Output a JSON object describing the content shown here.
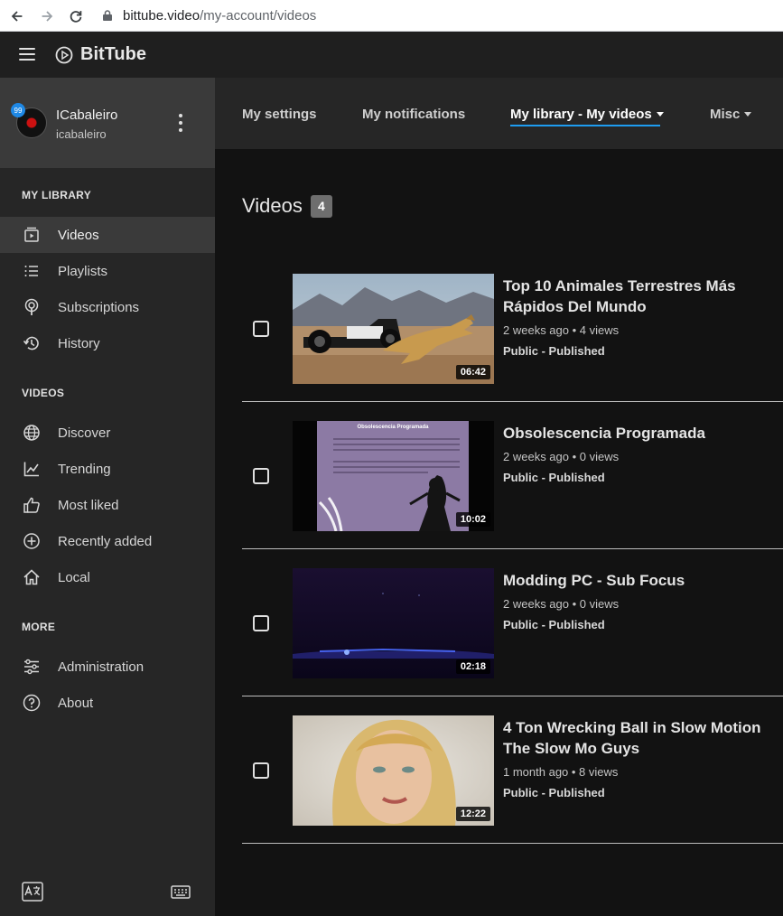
{
  "browser": {
    "url_host": "bittube.video",
    "url_path": "/my-account/videos"
  },
  "brand": {
    "name": "BitTube"
  },
  "account": {
    "name": "ICabaleiro",
    "handle": "icabaleiro",
    "badge": "99"
  },
  "sidebar": {
    "sections": [
      {
        "title": "MY LIBRARY"
      },
      {
        "title": "VIDEOS"
      },
      {
        "title": "MORE"
      }
    ],
    "items": [
      {
        "label": "Videos",
        "icon": "video-file-icon",
        "active": true
      },
      {
        "label": "Playlists",
        "icon": "playlist-icon"
      },
      {
        "label": "Subscriptions",
        "icon": "subscriptions-icon"
      },
      {
        "label": "History",
        "icon": "history-icon"
      },
      {
        "label": "Discover",
        "icon": "globe-icon"
      },
      {
        "label": "Trending",
        "icon": "trending-icon"
      },
      {
        "label": "Most liked",
        "icon": "thumbs-up-icon"
      },
      {
        "label": "Recently added",
        "icon": "plus-circle-icon"
      },
      {
        "label": "Local",
        "icon": "home-icon"
      },
      {
        "label": "Administration",
        "icon": "sliders-icon"
      },
      {
        "label": "About",
        "icon": "help-icon"
      }
    ]
  },
  "tabs": [
    {
      "label": "My settings"
    },
    {
      "label": "My notifications"
    },
    {
      "label": "My library - My videos",
      "active": true
    },
    {
      "label": "Misc"
    }
  ],
  "main": {
    "title": "Videos",
    "count": "4"
  },
  "videos": [
    {
      "title": "Top 10 Animales Terrestres Más Rápidos Del Mundo",
      "meta": "2 weeks ago • 4 views",
      "status": "Public - Published",
      "duration": "06:42"
    },
    {
      "title": "Obsolescencia Programada",
      "meta": "2 weeks ago • 0 views",
      "status": "Public - Published",
      "duration": "10:02"
    },
    {
      "title": "Modding PC - Sub Focus",
      "meta": "2 weeks ago • 0 views",
      "status": "Public - Published",
      "duration": "02:18"
    },
    {
      "title": "4 Ton Wrecking Ball in Slow Motion The Slow Mo Guys",
      "meta": "1 month ago • 8 views",
      "status": "Public - Published",
      "duration": "12:22"
    }
  ],
  "thumb_texts": {
    "slide_title": "Obsolescencia Programada"
  },
  "colors": {
    "accent": "#1e9cf0",
    "sidebar_bg": "#262626",
    "page_bg": "#121212"
  }
}
